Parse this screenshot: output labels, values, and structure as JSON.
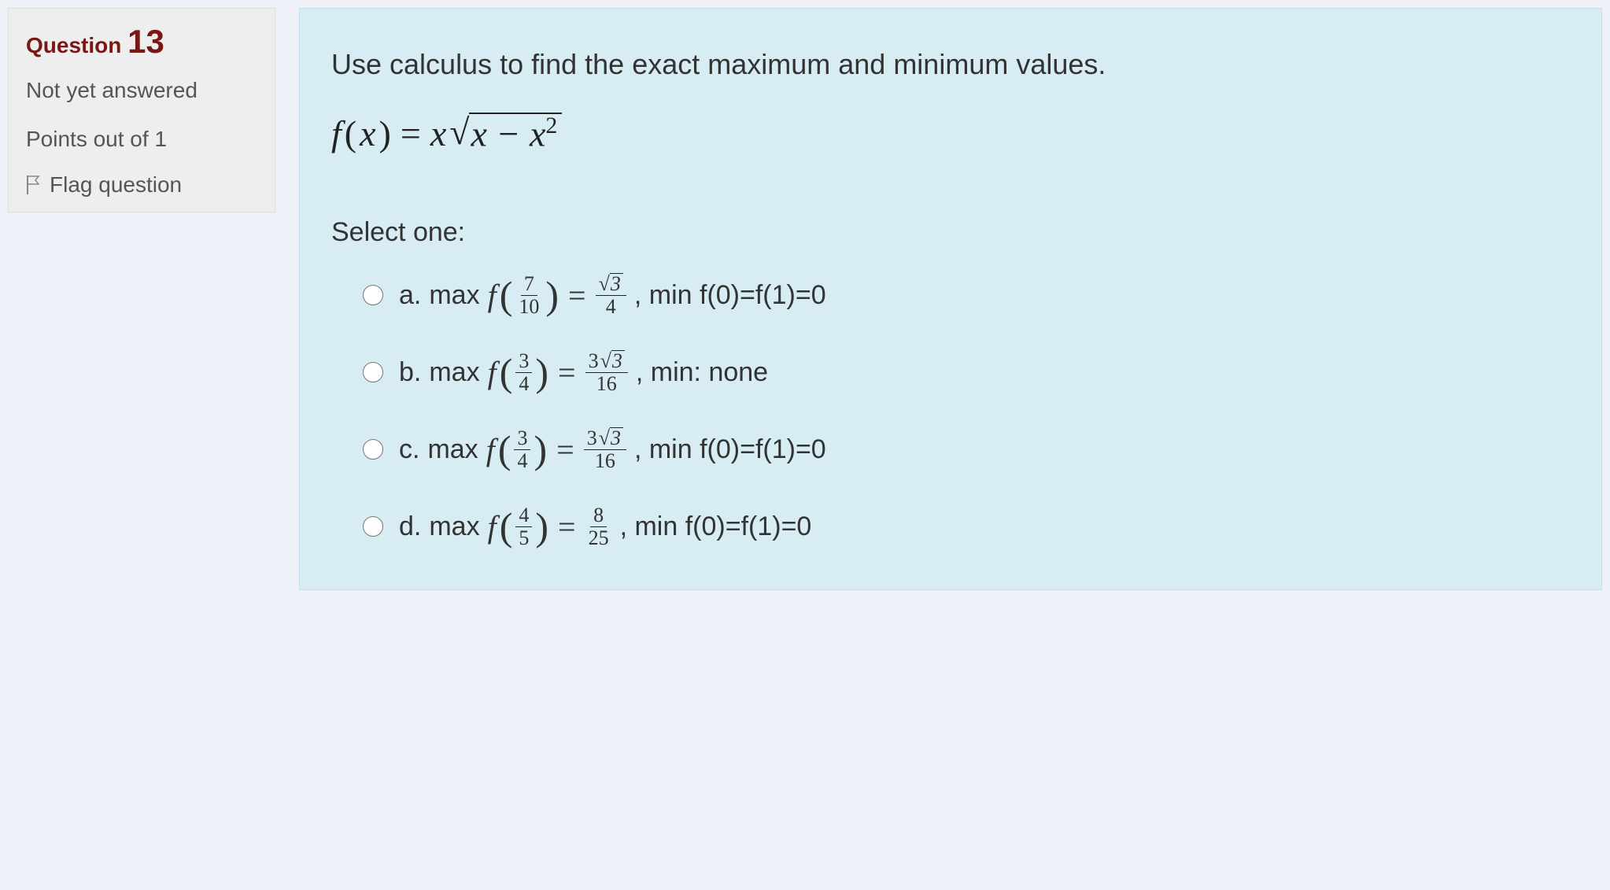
{
  "info": {
    "question_label": "Question",
    "question_number": "13",
    "status": "Not yet answered",
    "points": "Points out of 1",
    "flag": "Flag question"
  },
  "content": {
    "prompt": "Use calculus to find the exact maximum and minimum values.",
    "formula_fn": "f",
    "formula_var": "x",
    "formula_inner_a": "x",
    "formula_inner_b": "x",
    "select_label": "Select one:",
    "options": {
      "a": {
        "letter": "a.",
        "max_word": "max",
        "f_arg_num": "7",
        "f_arg_den": "10",
        "rhs_num_sqrt": "3",
        "rhs_num_pre": "",
        "rhs_den": "4",
        "suffix": ", min f(0)=f(1)=0"
      },
      "b": {
        "letter": "b.",
        "max_word": "max",
        "f_arg_num": "3",
        "f_arg_den": "4",
        "rhs_num_sqrt": "3",
        "rhs_num_pre": "3",
        "rhs_den": "16",
        "suffix": ", min: none"
      },
      "c": {
        "letter": "c.",
        "max_word": "max",
        "f_arg_num": "3",
        "f_arg_den": "4",
        "rhs_num_sqrt": "3",
        "rhs_num_pre": "3",
        "rhs_den": "16",
        "suffix": ", min f(0)=f(1)=0"
      },
      "d": {
        "letter": "d.",
        "max_word": "max",
        "f_arg_num": "4",
        "f_arg_den": "5",
        "rhs_num": "8",
        "rhs_den": "25",
        "suffix": ", min f(0)=f(1)=0"
      }
    }
  }
}
